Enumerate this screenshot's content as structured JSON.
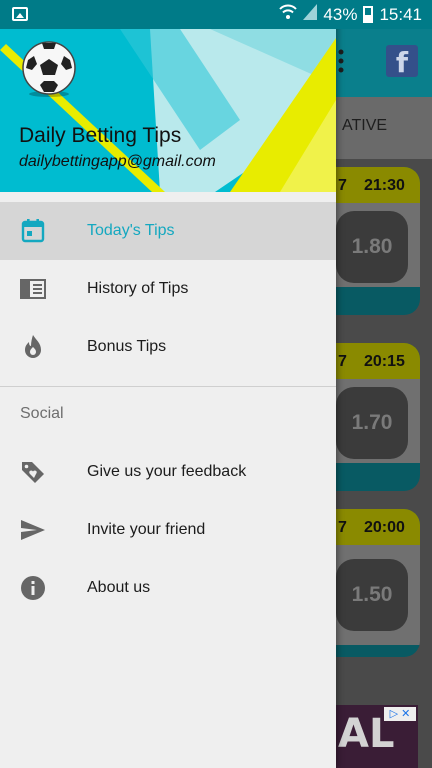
{
  "status_bar": {
    "battery": "43%",
    "time": "15:41"
  },
  "drawer": {
    "app_name": "Daily Betting Tips",
    "email": "dailybettingapp@gmail.com",
    "items": [
      {
        "label": "Today's Tips",
        "icon": "calendar-icon",
        "active": true
      },
      {
        "label": "History of Tips",
        "icon": "history-icon",
        "active": false
      },
      {
        "label": "Bonus Tips",
        "icon": "flame-icon",
        "active": false
      }
    ],
    "section_title": "Social",
    "social_items": [
      {
        "label": "Give us your feedback",
        "icon": "tag-heart-icon"
      },
      {
        "label": "Invite your friend",
        "icon": "send-icon"
      },
      {
        "label": "About us",
        "icon": "info-icon"
      }
    ]
  },
  "background": {
    "tab_label": "ATIVE",
    "cards": [
      {
        "day": "7",
        "time": "21:30",
        "odds": "1.80"
      },
      {
        "day": "7",
        "time": "20:15",
        "odds": "1.70"
      },
      {
        "day": "7",
        "time": "20:00",
        "odds": "1.50"
      }
    ],
    "ad_text": "AL"
  },
  "colors": {
    "accent": "#14a8c0",
    "header_cyan": "#00bcd0",
    "header_yellow": "#e8ec00",
    "status_bar": "#007b88"
  }
}
